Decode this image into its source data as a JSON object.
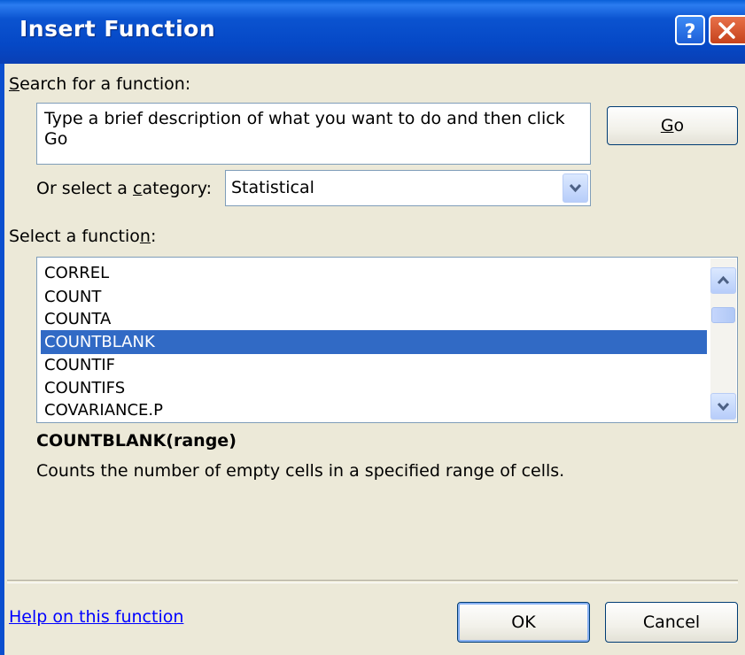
{
  "window": {
    "title": "Insert Function",
    "help_glyph": "?",
    "close_glyph": "X"
  },
  "search": {
    "label_prefix": "",
    "label_access": "S",
    "label_rest": "earch for a function:",
    "value": "Type a brief description of what you want to do and then click Go",
    "go_access": "G",
    "go_rest": "o"
  },
  "category": {
    "label_prefix": "Or select a ",
    "label_access": "c",
    "label_rest": "ategory:",
    "selected": "Statistical"
  },
  "function_list": {
    "label_prefix": "Select a functio",
    "label_access": "n",
    "label_rest": ":",
    "items": [
      "CORREL",
      "COUNT",
      "COUNTA",
      "COUNTBLANK",
      "COUNTIF",
      "COUNTIFS",
      "COVARIANCE.P"
    ],
    "selected_index": 3
  },
  "details": {
    "signature": "COUNTBLANK(range)",
    "description": "Counts the number of empty cells in a specified range of cells."
  },
  "footer": {
    "help_link": "Help on this function",
    "ok_label": "OK",
    "cancel_label": "Cancel"
  },
  "colors": {
    "titlebar": "#0548c6",
    "dialog_bg": "#ece9d8",
    "selection": "#316ac5",
    "link": "#0000ff"
  }
}
